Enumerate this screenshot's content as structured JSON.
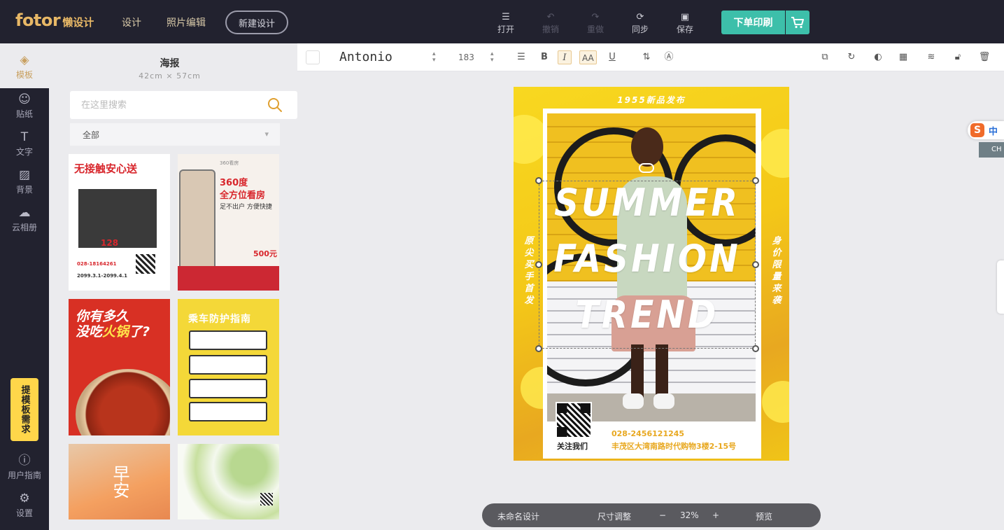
{
  "header": {
    "logo_main": "fotor",
    "logo_sub": "懒设计",
    "nav": [
      "设计",
      "照片编辑"
    ],
    "new_design": "新建设计",
    "tools": [
      {
        "icon": "menu-icon",
        "label": "打开"
      },
      {
        "icon": "undo-icon",
        "label": "撤销"
      },
      {
        "icon": "redo-icon",
        "label": "重做"
      },
      {
        "icon": "sync-icon",
        "label": "同步"
      },
      {
        "icon": "save-icon",
        "label": "保存"
      }
    ],
    "order_print": "下单印刷",
    "accent": "#3dbfaa"
  },
  "rail": {
    "items": [
      {
        "icon": "template-icon",
        "label": "模板"
      },
      {
        "icon": "sticker-icon",
        "label": "贴纸"
      },
      {
        "icon": "text-icon",
        "label": "文字"
      },
      {
        "icon": "background-icon",
        "label": "背景"
      },
      {
        "icon": "cloud-upload-icon",
        "label": "云相册"
      }
    ],
    "request": "提模板需求",
    "guide": "用户指南",
    "settings": "设置"
  },
  "panel": {
    "title": "海报",
    "size": "42cm × 57cm",
    "search_placeholder": "在这里搜索",
    "filter": "全部",
    "thumbs": {
      "t1": {
        "headline": "无接触安心送",
        "price": "128",
        "phone": "028-18164261",
        "date": "2099.3.1-2099.4.1"
      },
      "t2": {
        "brand": "360看房",
        "h1": "360度",
        "h2": "全方位看房",
        "sub": "足不出户 方便快捷",
        "price": "500元"
      },
      "t3": {
        "line1": "你有多久",
        "line2a": "没吃",
        "line2b": "火锅",
        "line2c": "了?"
      },
      "t4": {
        "headline": "乘车防护指南"
      },
      "t5": {
        "text": "早安"
      }
    }
  },
  "format_bar": {
    "font": "Antonio",
    "size": "183",
    "bold": "B",
    "italic": "I",
    "caps": "AA",
    "underline": "U"
  },
  "poster": {
    "top_text": "1955新品发布",
    "headline": [
      "SUMMER",
      "FASHION",
      "TREND"
    ],
    "left_vertical": "原尖买手首发",
    "right_vertical": "身价限量来袭",
    "follow": "关注我们",
    "phone": "028-2456121245",
    "address": "丰茂区大湾南路时代购物3楼2-15号"
  },
  "statusbar": {
    "name": "未命名设计",
    "resize": "尺寸调整",
    "minus": "−",
    "zoom": "32%",
    "plus": "+",
    "preview": "预览"
  },
  "ime": {
    "logo": "S",
    "mode": "中",
    "ch": "CH"
  }
}
